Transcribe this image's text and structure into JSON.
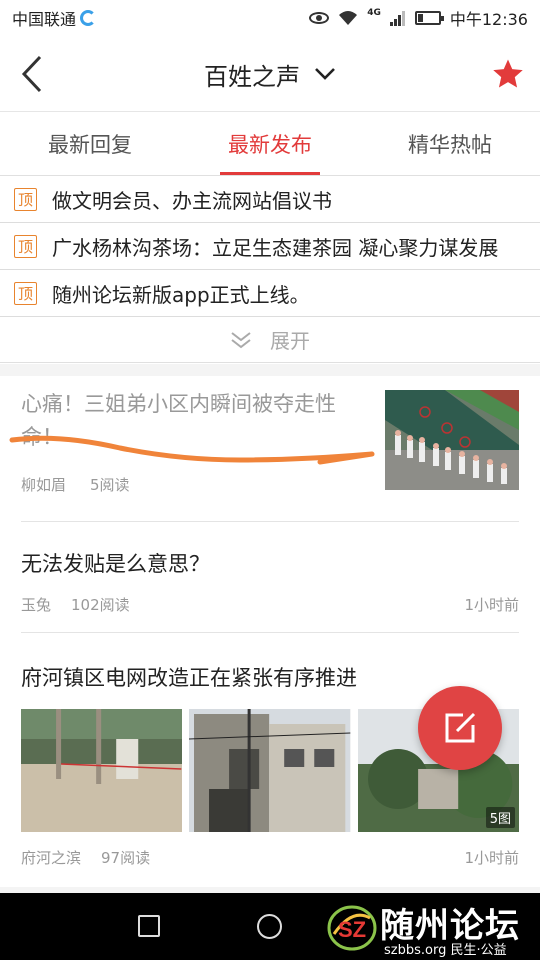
{
  "status_bar": {
    "carrier": "中国联通",
    "network": "4G",
    "time": "中午12:36"
  },
  "header": {
    "title": "百姓之声",
    "back_icon": "chevron-left-icon",
    "dropdown_icon": "chevron-down-icon",
    "favorite_icon": "star-icon",
    "accent_color": "#e23b3b"
  },
  "tabs": [
    {
      "label": "最新回复",
      "active": false
    },
    {
      "label": "最新发布",
      "active": true
    },
    {
      "label": "精华热帖",
      "active": false
    }
  ],
  "pinned": {
    "badge": "顶",
    "badge_color": "#e8842e",
    "items": [
      {
        "title": "做文明会员、办主流网站倡议书"
      },
      {
        "title": "广水杨林沟茶场：立足生态建茶园 凝心聚力谋发展"
      },
      {
        "title": "随州论坛新版app正式上线。"
      }
    ],
    "expand_label": "展开"
  },
  "posts": [
    {
      "title": "心痛！三姐弟小区内瞬间被夺走性命！",
      "author": "柳如眉",
      "reads": "5阅读"
    },
    {
      "title": "无法发贴是么意思？",
      "author": "玉兔",
      "reads": "102阅读",
      "time": "1小时前"
    },
    {
      "title": "府河镇区电网改造正在紧张有序推进",
      "author": "府河之滨",
      "reads": "97阅读",
      "time": "1小时前",
      "image_count": "5图"
    }
  ],
  "fab": {
    "icon": "compose-icon"
  },
  "watermark": {
    "logo_text": "SZ",
    "title": "随州论坛",
    "subtitle": "szbbs.org 民生·公益"
  }
}
